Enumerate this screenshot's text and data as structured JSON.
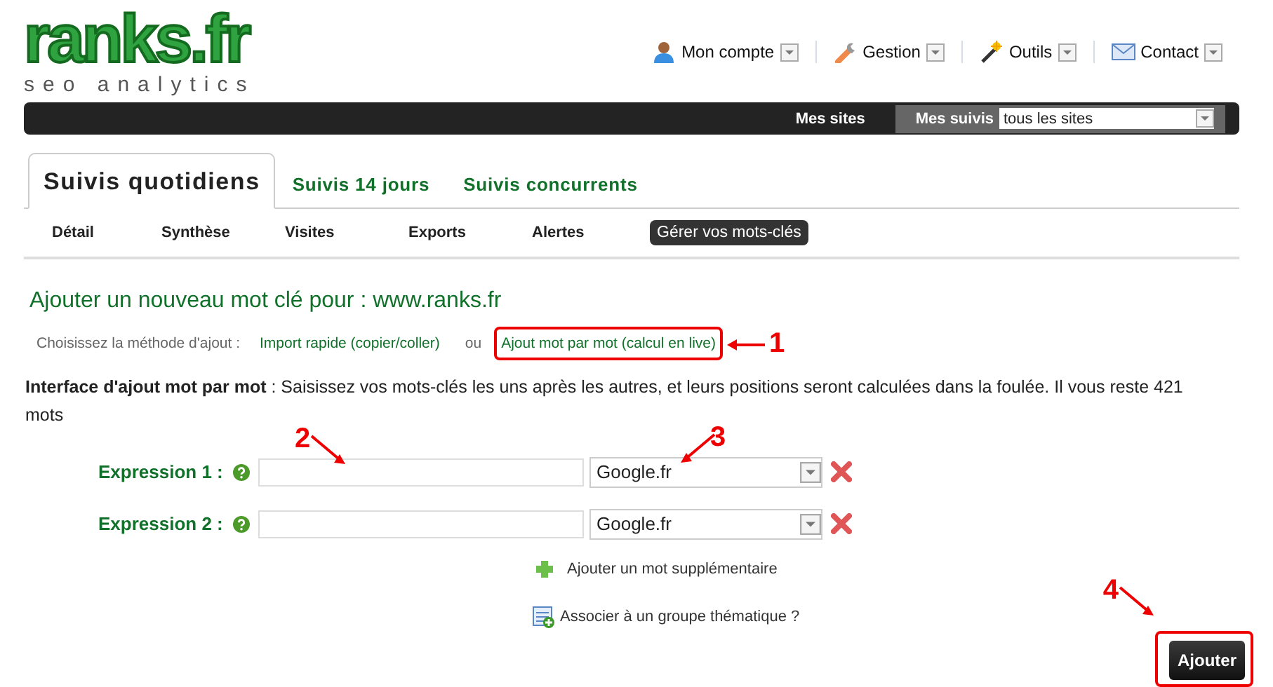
{
  "logo": {
    "name": "ranks.fr",
    "tagline": "seo analytics"
  },
  "top_menu": [
    {
      "label": "Mon compte"
    },
    {
      "label": "Gestion"
    },
    {
      "label": "Outils"
    },
    {
      "label": "Contact"
    }
  ],
  "site_bar": {
    "mes_sites": "Mes sites",
    "mes_suivis": "Mes suivis",
    "site_select": "tous les sites"
  },
  "tabs": [
    {
      "label": "Suivis quotidiens",
      "selected": true
    },
    {
      "label": "Suivis 14 jours",
      "selected": false
    },
    {
      "label": "Suivis concurrents",
      "selected": false
    }
  ],
  "subnav": [
    {
      "label": "Détail",
      "selected": false
    },
    {
      "label": "Synthèse",
      "selected": false
    },
    {
      "label": "Visites",
      "selected": false
    },
    {
      "label": "Exports",
      "selected": false
    },
    {
      "label": "Alertes",
      "selected": false
    },
    {
      "label": "Gérer vos mots-clés",
      "selected": true
    }
  ],
  "heading": "Ajouter un nouveau mot clé pour : www.ranks.fr",
  "method": {
    "label": "Choisissez la méthode d'ajout :",
    "separator": "ou",
    "options": [
      {
        "label": "Import rapide (copier/coller)"
      },
      {
        "label": "Ajout mot par mot (calcul en live)",
        "callout": {
          "number": "1",
          "kind": "left"
        }
      }
    ]
  },
  "intro": "**Interface d'ajout mot par mot** : Saisissez vos mots-clés les uns après les autres, et leurs positions seront calculées dans la foulée. Il vous reste 421 mots",
  "expressions": [
    {
      "label": "Expression 1 :",
      "engine": "Google.fr",
      "field_callout": {
        "number": "2",
        "kind": "downright"
      },
      "engine_callout": {
        "number": "3",
        "kind": "downleft"
      }
    },
    {
      "label": "Expression 2 :",
      "engine": "Google.fr"
    }
  ],
  "add_more": "Ajouter un mot supplémentaire",
  "group_link": "Associer à un groupe thématique ?",
  "submit": {
    "label": "Ajouter",
    "callout": {
      "number": "4",
      "kind": "box"
    }
  }
}
